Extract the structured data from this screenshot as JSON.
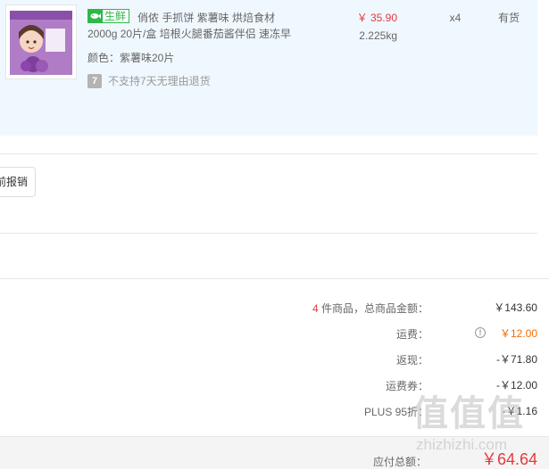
{
  "product": {
    "fresh_tag": "生鲜",
    "title_line1": "俏侬 手抓饼 紫薯味 烘焙食材",
    "title_line2": "2000g 20片/盒 培根火腿番茄酱伴侣 速冻早",
    "color_label": "颜色：紫薯味20片",
    "no_return_icon": "7",
    "no_return_text": "不支持7天无理由退货",
    "price": "￥ 35.90",
    "weight": "2.225kg",
    "quantity": "x4",
    "stock": "有货"
  },
  "invoice": {
    "button_label": "前报销"
  },
  "summary": {
    "items_count": "4",
    "items_label": " 件商品，总商品金额：",
    "items_value": "￥143.60",
    "shipping_label": "运费：",
    "shipping_value": "￥12.00",
    "cashback_label": "返现：",
    "cashback_value": "-￥71.80",
    "shipping_coupon_label": "运费券：",
    "shipping_coupon_value": "-￥12.00",
    "plus_label": "PLUS 95折：",
    "plus_value": "-￥1.16"
  },
  "total": {
    "label": "应付总额：",
    "value": "￥64.64"
  },
  "watermark": {
    "main": "值值值",
    "sub": "zhizhizhi.com"
  },
  "colors": {
    "accent_red": "#e4393c",
    "fresh_green": "#2eb84a",
    "shipping_orange": "#f56a00",
    "product_bg": "#f0f8ff"
  }
}
